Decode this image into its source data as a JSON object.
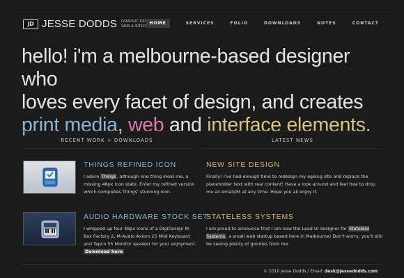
{
  "header": {
    "logo_mark": "JD",
    "name": "JESSE DODDS",
    "tagline_line1": "GRAPHIC DESIGN",
    "tagline_line2": "WEB & INTERFACE",
    "nav": [
      "HOME",
      "SERVICES",
      "FOLIO",
      "DOWNLOADS",
      "NOTES",
      "CONTACT"
    ],
    "active_nav": "HOME"
  },
  "hero": {
    "line1": "hello! i'm a melbourne-based designer who",
    "line2": "loves every facet of design, and creates",
    "print": "print media",
    "comma": ", ",
    "web": "web",
    "and": " and ",
    "interface": "interface elements",
    "period": "."
  },
  "works": {
    "heading": "RECENT WORK + DOWNLOADS",
    "items": [
      {
        "title": "THINGS REFINED ICON",
        "body_pre": "I adore ",
        "body_hl": "Things",
        "body_post": ", although one thing irked me, a missing 48px icon state. Enter my refined version which completes Things' stunning icon."
      },
      {
        "title": "AUDIO HARDWARE STOCK SET",
        "body": "I whipped up four 48px icons of a DigiDesign M-Box Factory 2, M-Audio Axiom 25 Midi Keyboard and Tapco S5 Monitor speaker for your enjoyment. ",
        "link": "Download here"
      }
    ]
  },
  "news": {
    "heading": "LATEST NEWS",
    "items": [
      {
        "title": "NEW SITE DESIGN",
        "body": "Finally! I've had enough time to redesign my ageing site and replace the placeholder text with real content! Have a look around and feel free to drop me an email/IM at any time. Hope you all enjoy it."
      },
      {
        "title": "STATELESS SYSTEMS",
        "body_pre": "I am proud to announce that I am now the Lead UI designer for ",
        "body_hl": "Stateless Systems",
        "body_post": ", a small web startup based here in Melbourne! Don't worry, you'll still be seeing plenty of goodies from me."
      }
    ]
  },
  "footer": {
    "copyright": "© 2010 Jesse Dodds / Email: ",
    "email": "desk@jessedodds.com"
  },
  "colors": {
    "background": "#1b1b1b",
    "blue": "#8ab6d6",
    "pink": "#d77ba8",
    "gold": "#d9c47a"
  }
}
